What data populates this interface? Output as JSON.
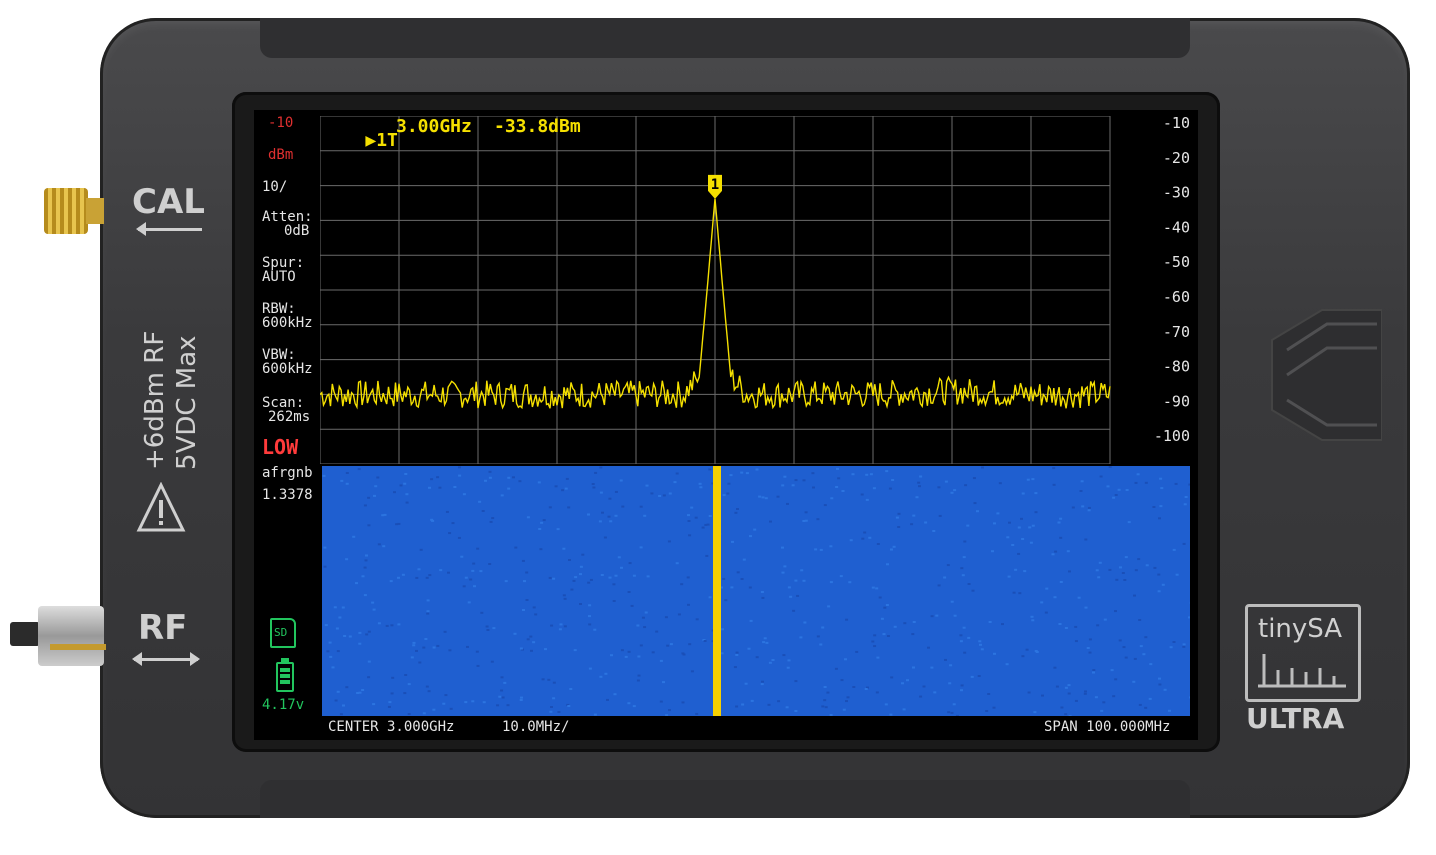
{
  "device": {
    "cal_label": "CAL",
    "rf_label": "RF",
    "side_text_line1": "+6dBm RF",
    "side_text_line2": "5VDC Max",
    "brand_name": "tinySA",
    "brand_sub": "ULTRA"
  },
  "left_panel": {
    "ref_level": "-10",
    "unit": "dBm",
    "scale": "10/",
    "atten_label": "Atten:",
    "atten_value": "0dB",
    "spur_label": "Spur:",
    "spur_value": "AUTO",
    "rbw_label": "RBW:",
    "rbw_value": "600kHz",
    "vbw_label": "VBW:",
    "vbw_value": "600kHz",
    "scan_label": "Scan:",
    "scan_value": "262ms",
    "mode": "LOW",
    "mode_sub": "afrgnb",
    "mode_num": "1.3378",
    "sd_label": "SD",
    "battery_voltage": "4.17v"
  },
  "marker": {
    "label": "1T",
    "freq": "3.00GHz",
    "level": "-33.8dBm",
    "number": "1"
  },
  "footer": {
    "center": "CENTER 3.000GHz",
    "per_div": "10.0MHz/",
    "span": "SPAN 100.000MHz"
  },
  "colors": {
    "trace": "#f5e000",
    "grid": "#6b6b6b",
    "waterfall_bg": "#1f5fd0",
    "waterfall_line": "#f5d000",
    "ref_text": "#e03030",
    "low_text": "#ff3b3b",
    "battery": "#22c55e"
  },
  "chart_data": {
    "type": "line",
    "xlabel": "",
    "ylabel": "",
    "x_range_mhz": [
      2950,
      3050
    ],
    "ylim": [
      -110,
      -10
    ],
    "yticks": [
      "-10",
      "-20",
      "-30",
      "-40",
      "-50",
      "-60",
      "-70",
      "-80",
      "-90",
      "-100"
    ],
    "grid": true,
    "series": [
      {
        "x_mhz": [
          2950,
          2960,
          2970,
          2980,
          2990,
          2996,
          2998,
          2999,
          3000,
          3001,
          3002,
          3004,
          3010,
          3020,
          3030,
          3040,
          3050
        ],
        "values_dbm": [
          -90,
          -90,
          -90,
          -90,
          -90,
          -90,
          -85,
          -60,
          -33.8,
          -60,
          -85,
          -90,
          -90,
          -90,
          -89,
          -90,
          -90
        ]
      }
    ],
    "waterfall_signal_mhz": 3000
  }
}
